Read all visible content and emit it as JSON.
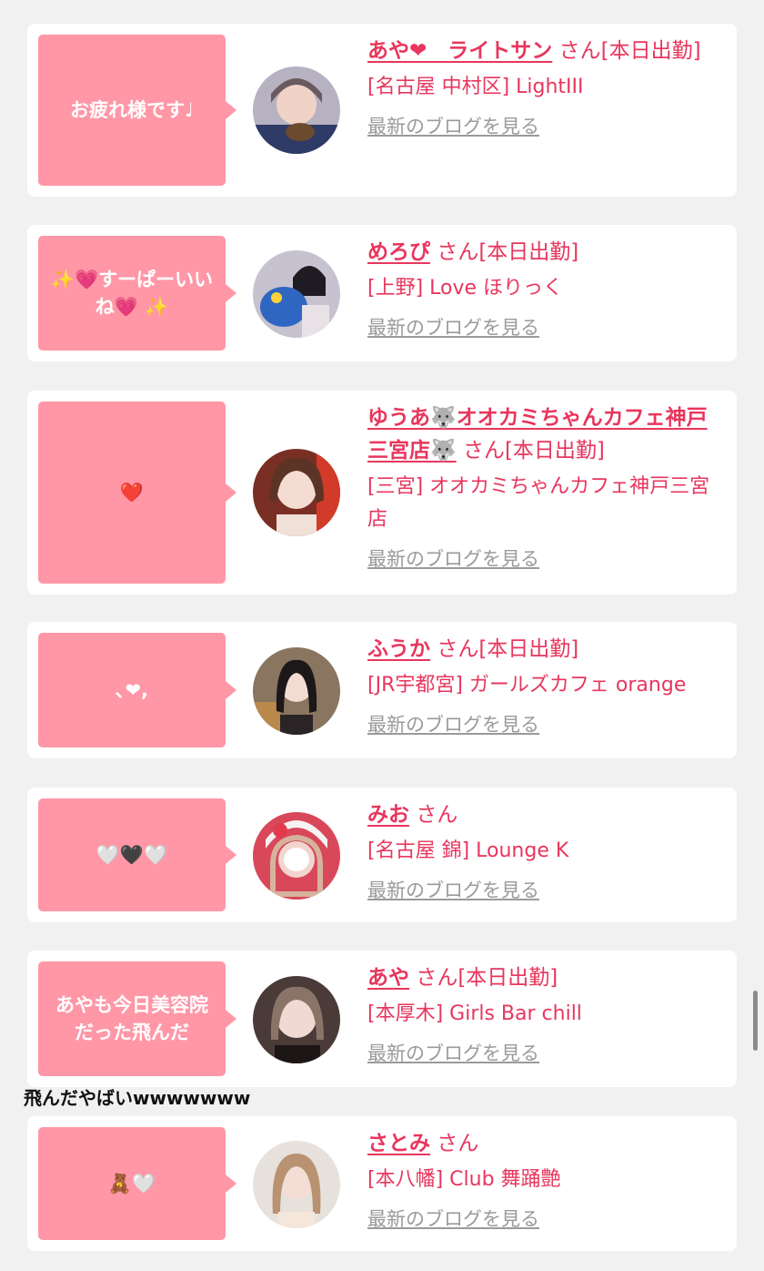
{
  "colors": {
    "accent": "#e8365d",
    "bubble": "#ff97a7",
    "link_gray": "#9a9a9a",
    "background": "#f1f1f1"
  },
  "cards": [
    {
      "bubble": "お疲れ様です♩",
      "name": "あや❤︎　ライトサン",
      "suffix": "さん[本日出勤]",
      "shop": "[名古屋 中村区] LightIII",
      "blog": "最新のブログを見る",
      "avatar": "avatar-woman-icon"
    },
    {
      "bubble": "✨💗すーぱーいいね💗 ✨",
      "name": "めろぴ",
      "suffix": "さん[本日出勤]",
      "shop": "[上野] Love ほりっく",
      "blog": "最新のブログを見る",
      "avatar": "avatar-woman-icon"
    },
    {
      "bubble": "❤️",
      "name": "ゆうあ🐺オオカミちゃんカフェ神戸三宮店🐺",
      "suffix": "さん[本日出勤]",
      "shop": "[三宮] オオカミちゃんカフェ神戸三宮店",
      "blog": "最新のブログを見る",
      "avatar": "avatar-woman-icon"
    },
    {
      "bubble": "､❤︎,",
      "name": "ふうか",
      "suffix": "さん[本日出勤]",
      "shop": "[JR宇都宮] ガールズカフェ orange",
      "blog": "最新のブログを見る",
      "avatar": "avatar-woman-icon"
    },
    {
      "bubble": "🤍🖤🤍",
      "name": "みお",
      "suffix": "さん",
      "shop": "[名古屋 錦] Lounge K",
      "blog": "最新のブログを見る",
      "avatar": "avatar-woman-icon"
    },
    {
      "bubble": "あやも今日美容院だった飛んだ",
      "name": "あや",
      "suffix": "さん[本日出勤]",
      "shop": "[本厚木] Girls Bar chill",
      "blog": "最新のブログを見る",
      "avatar": "avatar-woman-icon"
    },
    {
      "bubble": "🧸🤍",
      "name": "さとみ",
      "suffix": "さん",
      "shop": "[本八幡] Club 舞踊艶",
      "blog": "最新のブログを見る",
      "avatar": "avatar-woman-icon"
    }
  ],
  "caption": "飛んだやばいwwwwwww"
}
